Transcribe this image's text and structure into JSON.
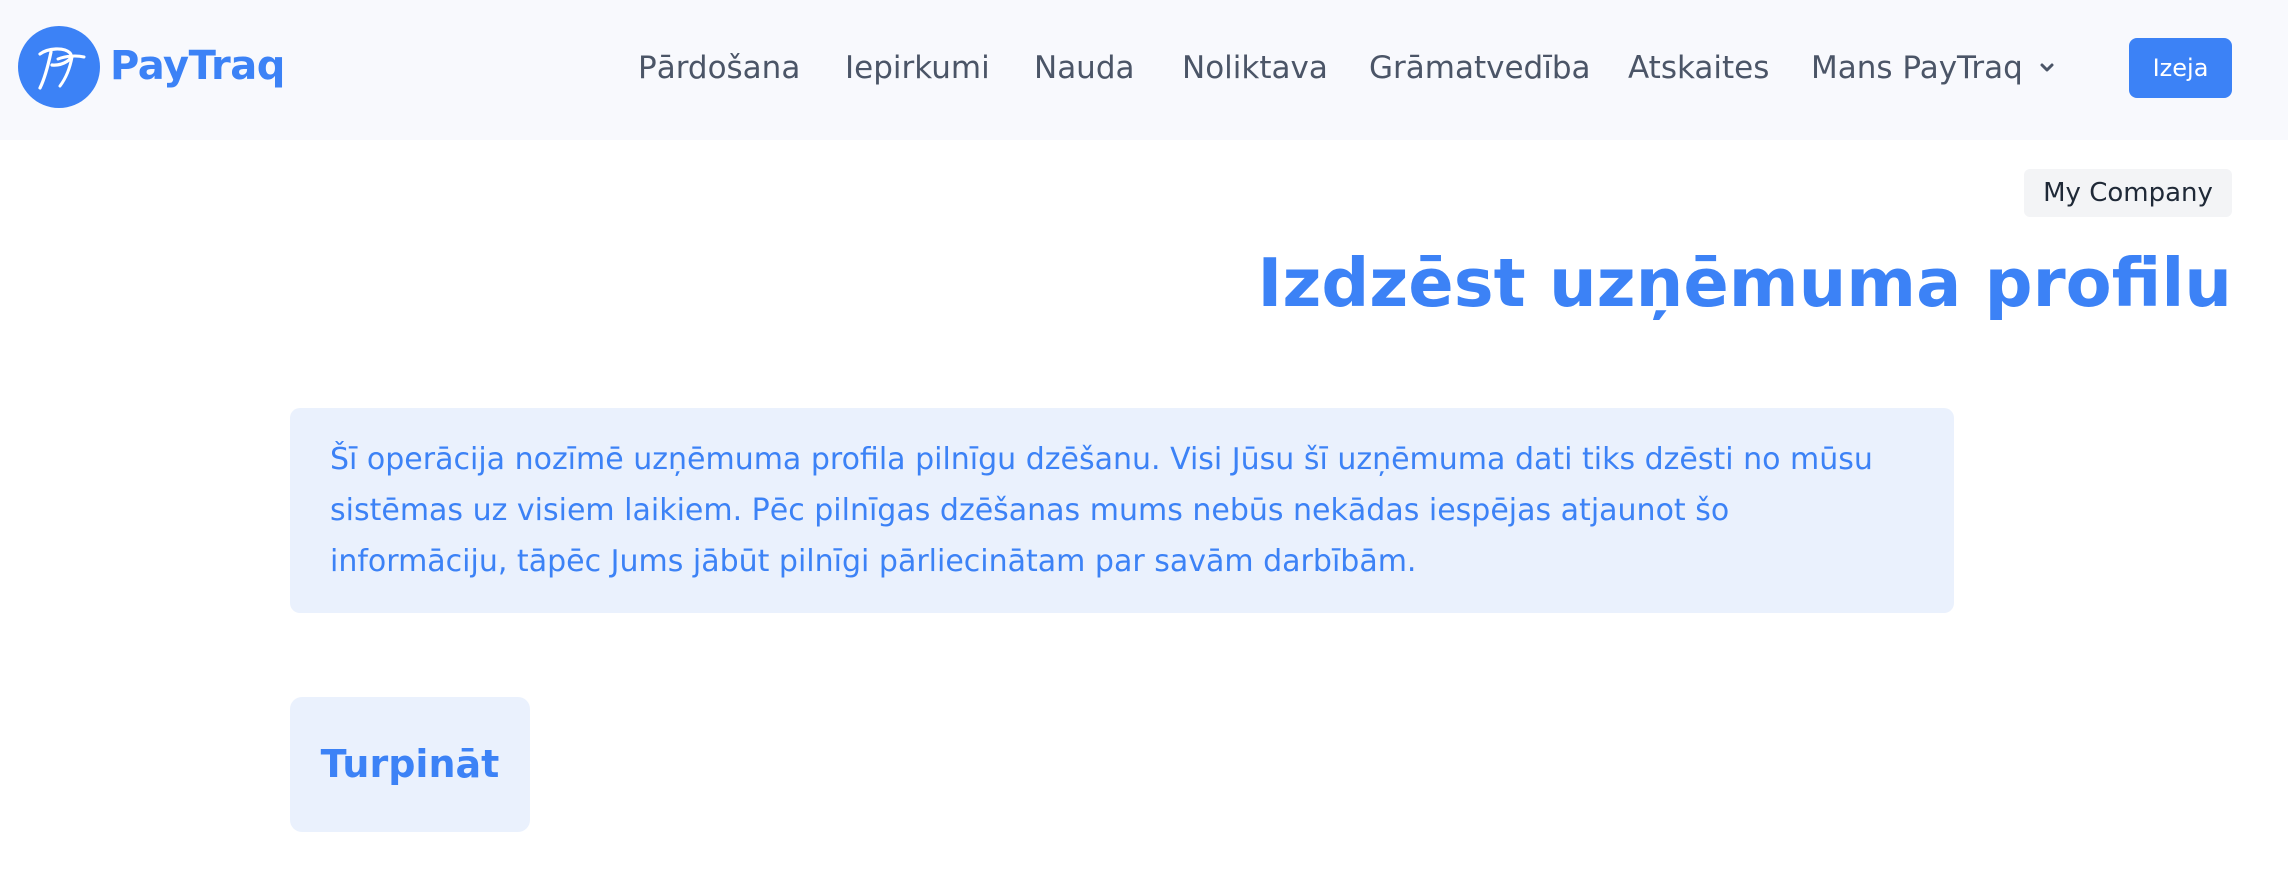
{
  "brand": {
    "name": "PayTraq",
    "logo_initials": "PT",
    "accent_color": "#3c82f6"
  },
  "nav": {
    "items": [
      {
        "label": "Pārdošana"
      },
      {
        "label": "Iepirkumi"
      },
      {
        "label": "Nauda"
      },
      {
        "label": "Noliktava"
      },
      {
        "label": "Grāmatvedība"
      },
      {
        "label": "Atskaites"
      },
      {
        "label": "Mans PayTraq",
        "icon": "chevron-down-icon"
      }
    ],
    "logout_label": "Izeja"
  },
  "company": {
    "name": "My Company"
  },
  "page": {
    "title": "Izdzēst uzņēmuma profilu",
    "warning_text": "Šī operācija nozīmē uzņēmuma profila pilnīgu dzēšanu. Visi Jūsu šī uzņēmuma dati tiks dzēsti no mūsu sistēmas uz visiem laikiem. Pēc pilnīgas dzēšanas mums nebūs nekādas iespējas atjaunot šo informāciju, tāpēc Jums jābūt pilnīgi pārliecinātam par savām darbībām.",
    "continue_label": "Turpināt"
  }
}
